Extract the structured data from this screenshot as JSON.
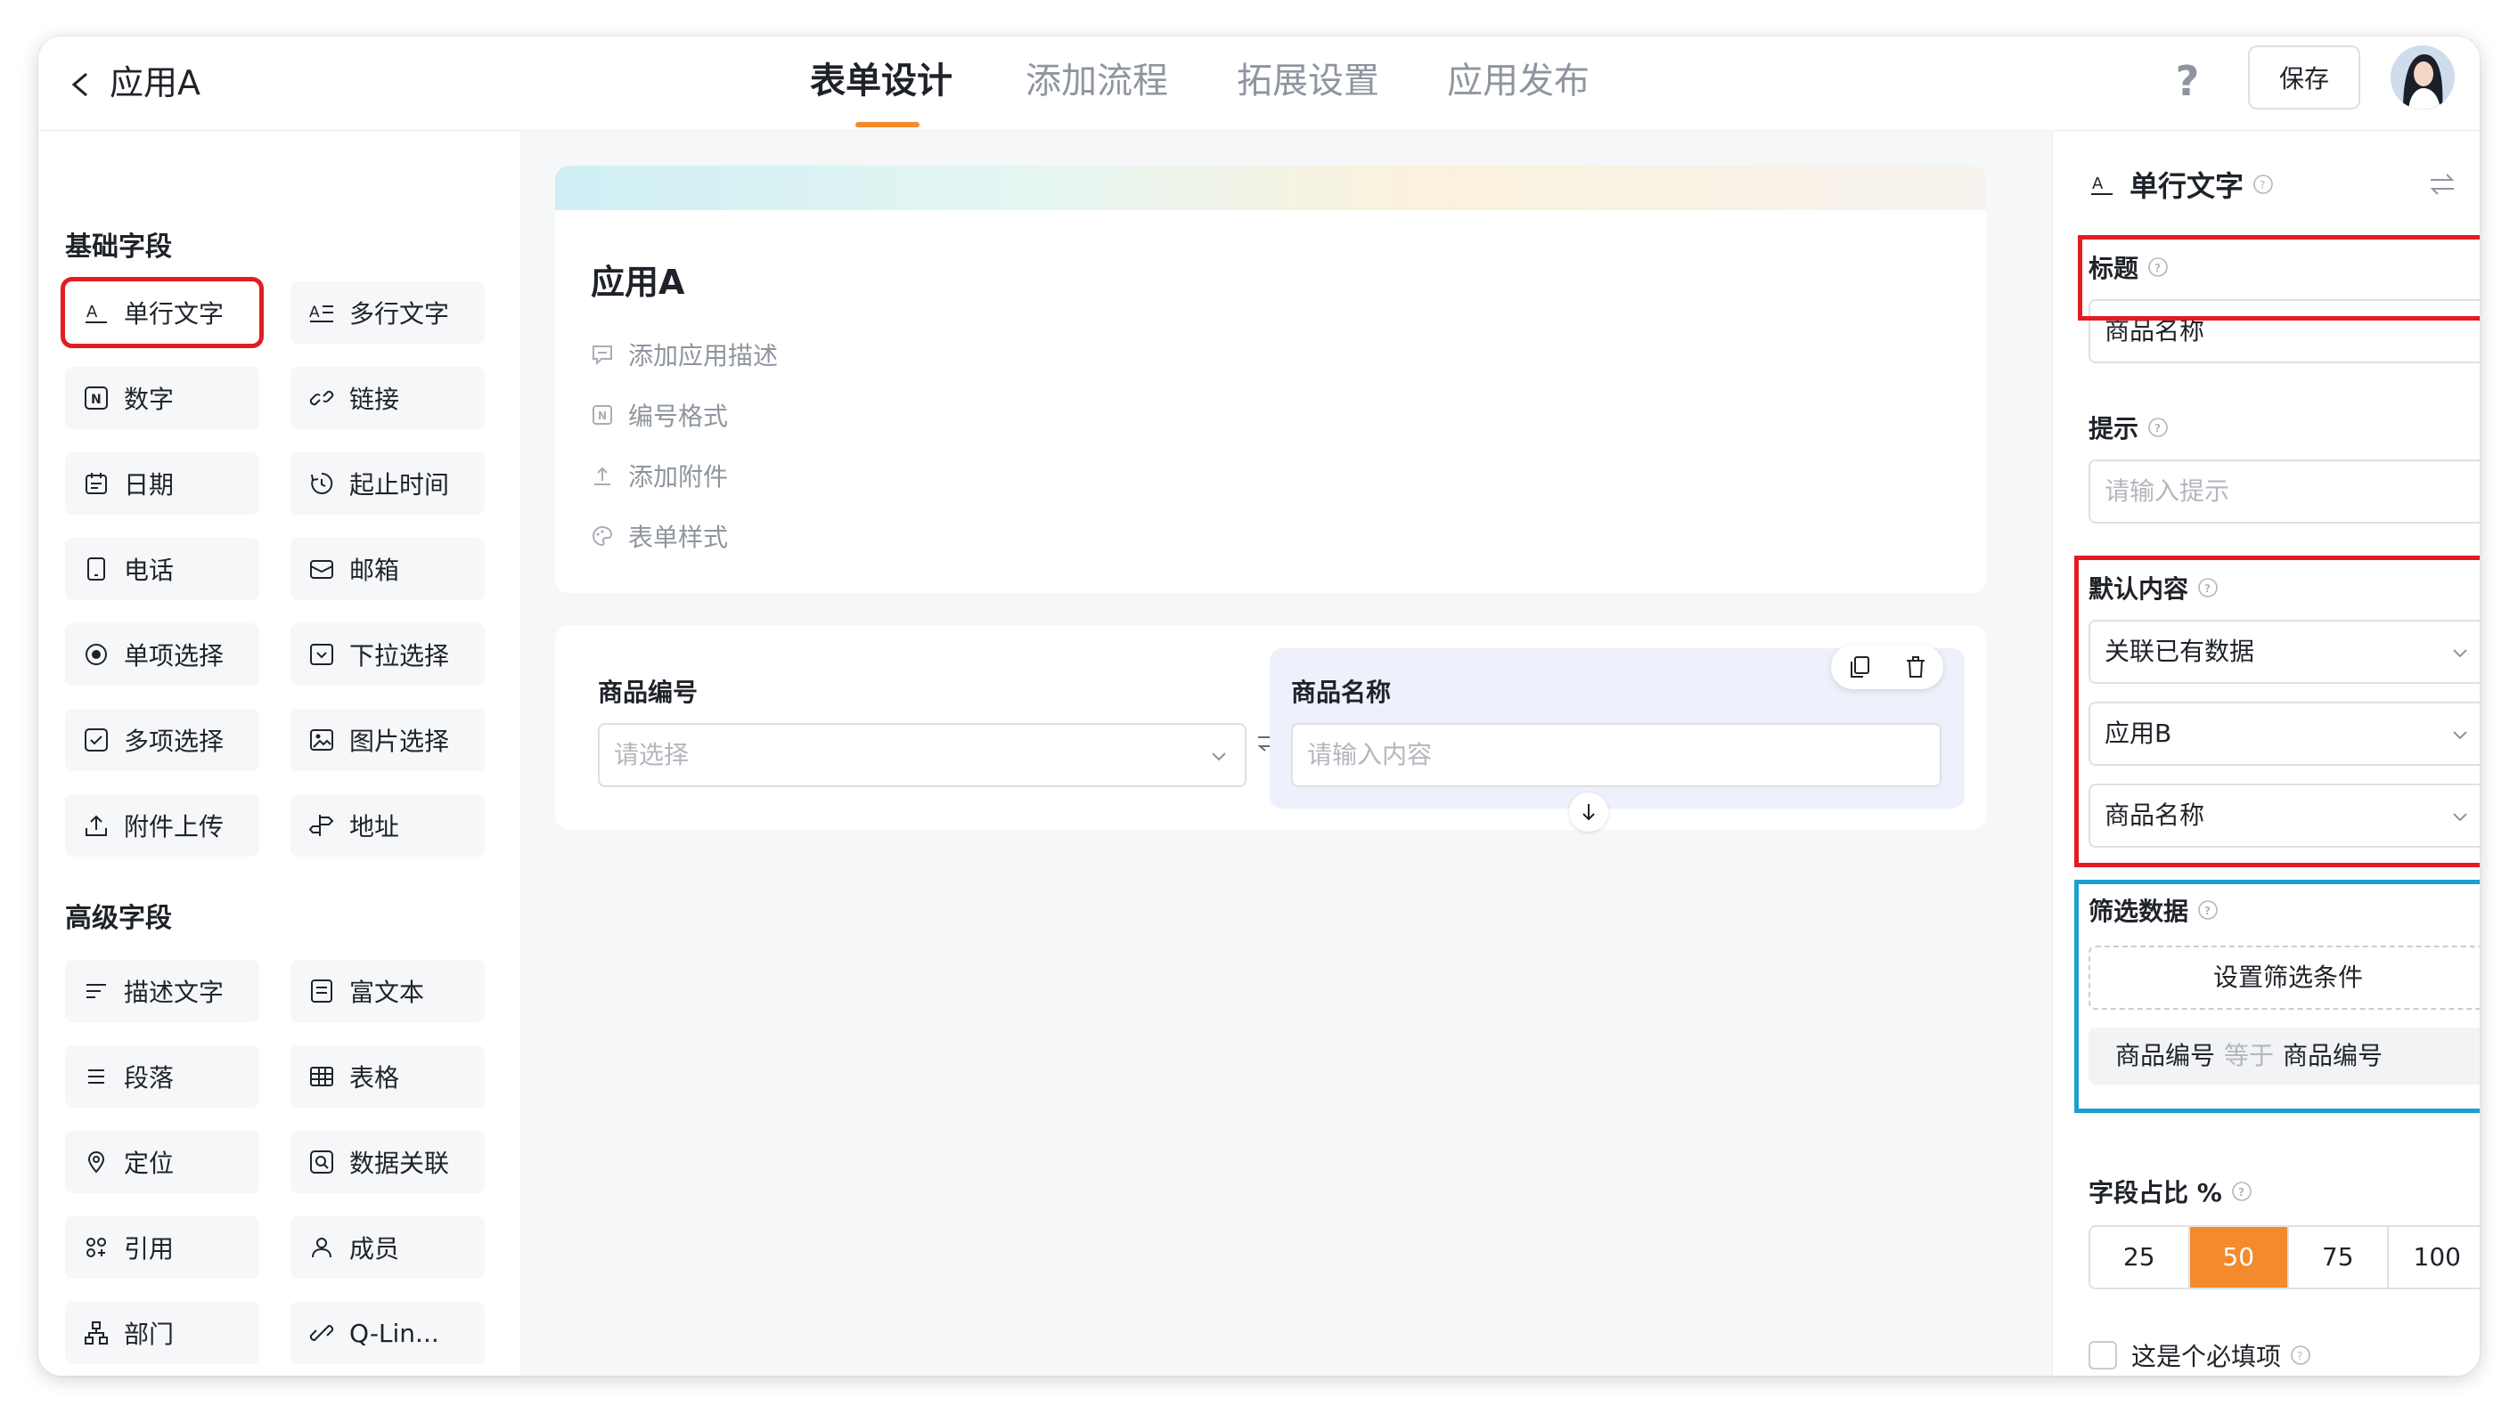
{
  "header": {
    "app_name": "应用A",
    "tabs": [
      {
        "label": "表单设计",
        "active": true
      },
      {
        "label": "添加流程",
        "active": false
      },
      {
        "label": "拓展设置",
        "active": false
      },
      {
        "label": "应用发布",
        "active": false
      }
    ],
    "help_label": "?",
    "save_label": "保存"
  },
  "sidebar": {
    "basic_title": "基础字段",
    "advanced_title": "高级字段",
    "basic_fields": [
      {
        "label": "单行文字",
        "icon": "single-line-text-icon",
        "selected": true
      },
      {
        "label": "多行文字",
        "icon": "multi-line-text-icon"
      },
      {
        "label": "数字",
        "icon": "number-icon"
      },
      {
        "label": "链接",
        "icon": "link-icon"
      },
      {
        "label": "日期",
        "icon": "calendar-icon"
      },
      {
        "label": "起止时间",
        "icon": "time-range-icon"
      },
      {
        "label": "电话",
        "icon": "phone-icon"
      },
      {
        "label": "邮箱",
        "icon": "mail-icon"
      },
      {
        "label": "单项选择",
        "icon": "radio-icon"
      },
      {
        "label": "下拉选择",
        "icon": "dropdown-icon"
      },
      {
        "label": "多项选择",
        "icon": "checkbox-icon"
      },
      {
        "label": "图片选择",
        "icon": "image-icon"
      },
      {
        "label": "附件上传",
        "icon": "upload-icon"
      },
      {
        "label": "地址",
        "icon": "signpost-icon"
      }
    ],
    "advanced_fields": [
      {
        "label": "描述文字",
        "icon": "description-icon"
      },
      {
        "label": "富文本",
        "icon": "rich-text-icon"
      },
      {
        "label": "段落",
        "icon": "paragraph-icon"
      },
      {
        "label": "表格",
        "icon": "table-icon"
      },
      {
        "label": "定位",
        "icon": "location-icon"
      },
      {
        "label": "数据关联",
        "icon": "data-link-icon"
      },
      {
        "label": "引用",
        "icon": "reference-icon"
      },
      {
        "label": "成员",
        "icon": "member-icon"
      },
      {
        "label": "部门",
        "icon": "department-icon"
      },
      {
        "label": "Q-Lin...",
        "icon": "q-link-icon"
      }
    ]
  },
  "canvas": {
    "form_title": "应用A",
    "meta_items": [
      {
        "label": "添加应用描述",
        "icon": "comment-icon"
      },
      {
        "label": "编号格式",
        "icon": "number-format-icon"
      },
      {
        "label": "添加附件",
        "icon": "attachment-upload-icon"
      },
      {
        "label": "表单样式",
        "icon": "palette-icon"
      }
    ],
    "fields": [
      {
        "label": "商品编号",
        "placeholder": "请选择"
      },
      {
        "label": "商品名称",
        "placeholder": "请输入内容"
      }
    ]
  },
  "panel": {
    "field_type": "单行文字",
    "title_label": "标题",
    "title_value": "商品名称",
    "hint_label": "提示",
    "hint_placeholder": "请输入提示",
    "default_label": "默认内容",
    "default_selects": [
      "关联已有数据",
      "应用B",
      "商品名称"
    ],
    "filter_label": "筛选数据",
    "filter_button": "设置筛选条件",
    "condition": {
      "left": "商品编号",
      "op": "等于",
      "right": "商品编号"
    },
    "width_label": "字段占比 %",
    "width_options": [
      "25",
      "50",
      "75",
      "100"
    ],
    "width_selected": "50",
    "required_label": "这是个必填项"
  },
  "colors": {
    "accent": "#f38b2c",
    "highlight_red": "#e11d21",
    "highlight_blue": "#1a9fcf"
  }
}
